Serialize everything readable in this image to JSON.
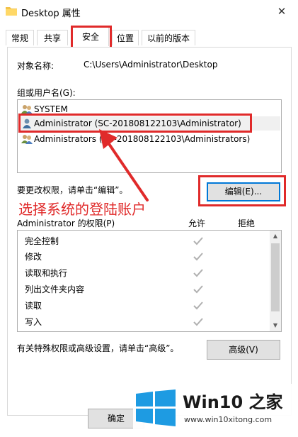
{
  "window": {
    "title": "Desktop 属性",
    "close_glyph": "✕"
  },
  "tabs": [
    {
      "label": "常规"
    },
    {
      "label": "共享"
    },
    {
      "label": "安全"
    },
    {
      "label": "位置"
    },
    {
      "label": "以前的版本"
    }
  ],
  "object": {
    "label": "对象名称:",
    "value": "C:\\Users\\Administrator\\Desktop"
  },
  "group": {
    "label": "组或用户名(G):",
    "items": [
      {
        "label": "SYSTEM"
      },
      {
        "label": "Administrator (SC-201808122103\\Administrator)"
      },
      {
        "label": "Administrators (SC-201808122103\\Administrators)"
      }
    ]
  },
  "edit": {
    "hint": "要更改权限，请单击“编辑”。",
    "button": "编辑(E)..."
  },
  "annotation": {
    "text": "选择系统的登陆账户",
    "color": "#e02a2a"
  },
  "permissions": {
    "title": "Administrator 的权限(P)",
    "allow_header": "允许",
    "deny_header": "拒绝",
    "rows": [
      {
        "label": "完全控制",
        "allow": true
      },
      {
        "label": "修改",
        "allow": true
      },
      {
        "label": "读取和执行",
        "allow": true
      },
      {
        "label": "列出文件夹内容",
        "allow": true
      },
      {
        "label": "读取",
        "allow": true
      },
      {
        "label": "写入",
        "allow": true
      }
    ]
  },
  "advanced": {
    "hint": "有关特殊权限或高级设置，请单击“高级”。",
    "button": "高级(V)"
  },
  "footer": {
    "ok_button": "确定"
  },
  "watermark": {
    "brand": "Win10 之家",
    "url": "www.win10xitong.com"
  }
}
